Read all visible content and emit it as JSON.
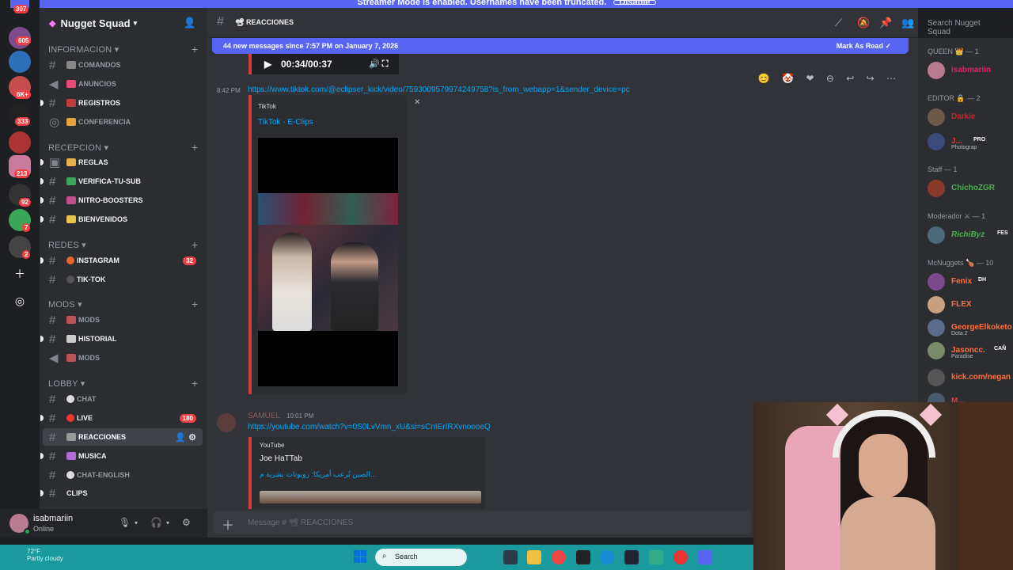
{
  "banner": {
    "text": "Streamer Mode is enabled. Usernames have been truncated.",
    "button": "Disable"
  },
  "rail": {
    "badges": [
      "307",
      "605",
      "6K+",
      "333",
      "213",
      "92",
      "7",
      "2"
    ]
  },
  "server": {
    "name": "Nugget Squad"
  },
  "categories": {
    "informacion": "INFORMACION",
    "recepcion": "RECEPCION",
    "redes": "REDES",
    "mods": "MODS",
    "lobby": "LOBBY"
  },
  "channels": {
    "comandos": "COMANDOS",
    "anuncios": "ANUNCIOS",
    "registros": "REGISTROS",
    "conferencia": "CONFERENCIA",
    "reglas": "REGLAS",
    "verifica": "VERIFICA-TU-SUB",
    "nitro": "NITRO-BOOSTERS",
    "bienvenidos": "BIENVENIDOS",
    "instagram": "INSTAGRAM",
    "instagram_count": "32",
    "tiktok": "TIK-TOK",
    "mods1": "MODS",
    "historial": "HISTORIAL",
    "mods2": "MODS",
    "chat": "CHAT",
    "live": "LIVE",
    "live_count": "180",
    "reacciones": "REACCIONES",
    "musica": "MUSICA",
    "chat_english": "CHAT-ENGLISH",
    "clips": "CLIPS"
  },
  "user": {
    "name": "isabmariin",
    "status": "Online"
  },
  "header": {
    "channel": "REACCIONES",
    "search_placeholder": "Search Nugget Squad"
  },
  "newbar": {
    "text": "44 new messages since 7:57 PM on January 7, 2026",
    "mark": "Mark As Read"
  },
  "media": {
    "time": "00:34/00:37"
  },
  "msg1": {
    "time": "8:42 PM",
    "link": "https://www.tiktok.com/@eclipser_kick/video/7593009579974249758?is_from_webapp=1&sender_device=pc",
    "provider": "TikTok",
    "title": "TikTok · E-Clips"
  },
  "msg2": {
    "author": "SAMUEL",
    "time": "10:01 PM",
    "link": "https://youtube.com/watch?v=0S0LvVmn_xU&si=sCnIErIRXvnoooeQ",
    "provider": "YouTube",
    "title": "Joe HaTTab",
    "desc": "الصين تُرعب أمريكا: روبوتات بشرية م..."
  },
  "composer": {
    "placeholder": "Message # 📽 REACCIONES"
  },
  "members": {
    "queen": "QUEEN 👑 — 1",
    "queen_1": "isabmariin",
    "editor": "EDITOR 🔒 — 2",
    "editor_1": "Darkie",
    "editor_2": "J...",
    "editor_2_tag": "PRO",
    "editor_2_sub": "Photograp",
    "staff": "Staff — 1",
    "staff_1": "ChichoZGR",
    "mod": "Moderador ⚔ — 1",
    "mod_1": "RichiByz",
    "mod_1_tag": "FES",
    "mc": "McNuggets 🍗 — 10",
    "mc_1": "Fenix",
    "mc_1_tag": "DH",
    "mc_2": "FLEX",
    "mc_3": "GeorgeElkoketo",
    "mc_3_sub": "Dota 2",
    "mc_4": "Jasoncc.",
    "mc_4_tag": "CAÑ",
    "mc_4_sub": "Paradise",
    "mc_5": "kick.com/negan",
    "mc_6": "M..."
  },
  "taskbar": {
    "weather_temp": "72°F",
    "weather_desc": "Partly cloudy",
    "search": "Search"
  },
  "colors": {
    "accent": "#5865f2",
    "taskbar": "#1b9a9e",
    "link": "#00a8fc"
  }
}
